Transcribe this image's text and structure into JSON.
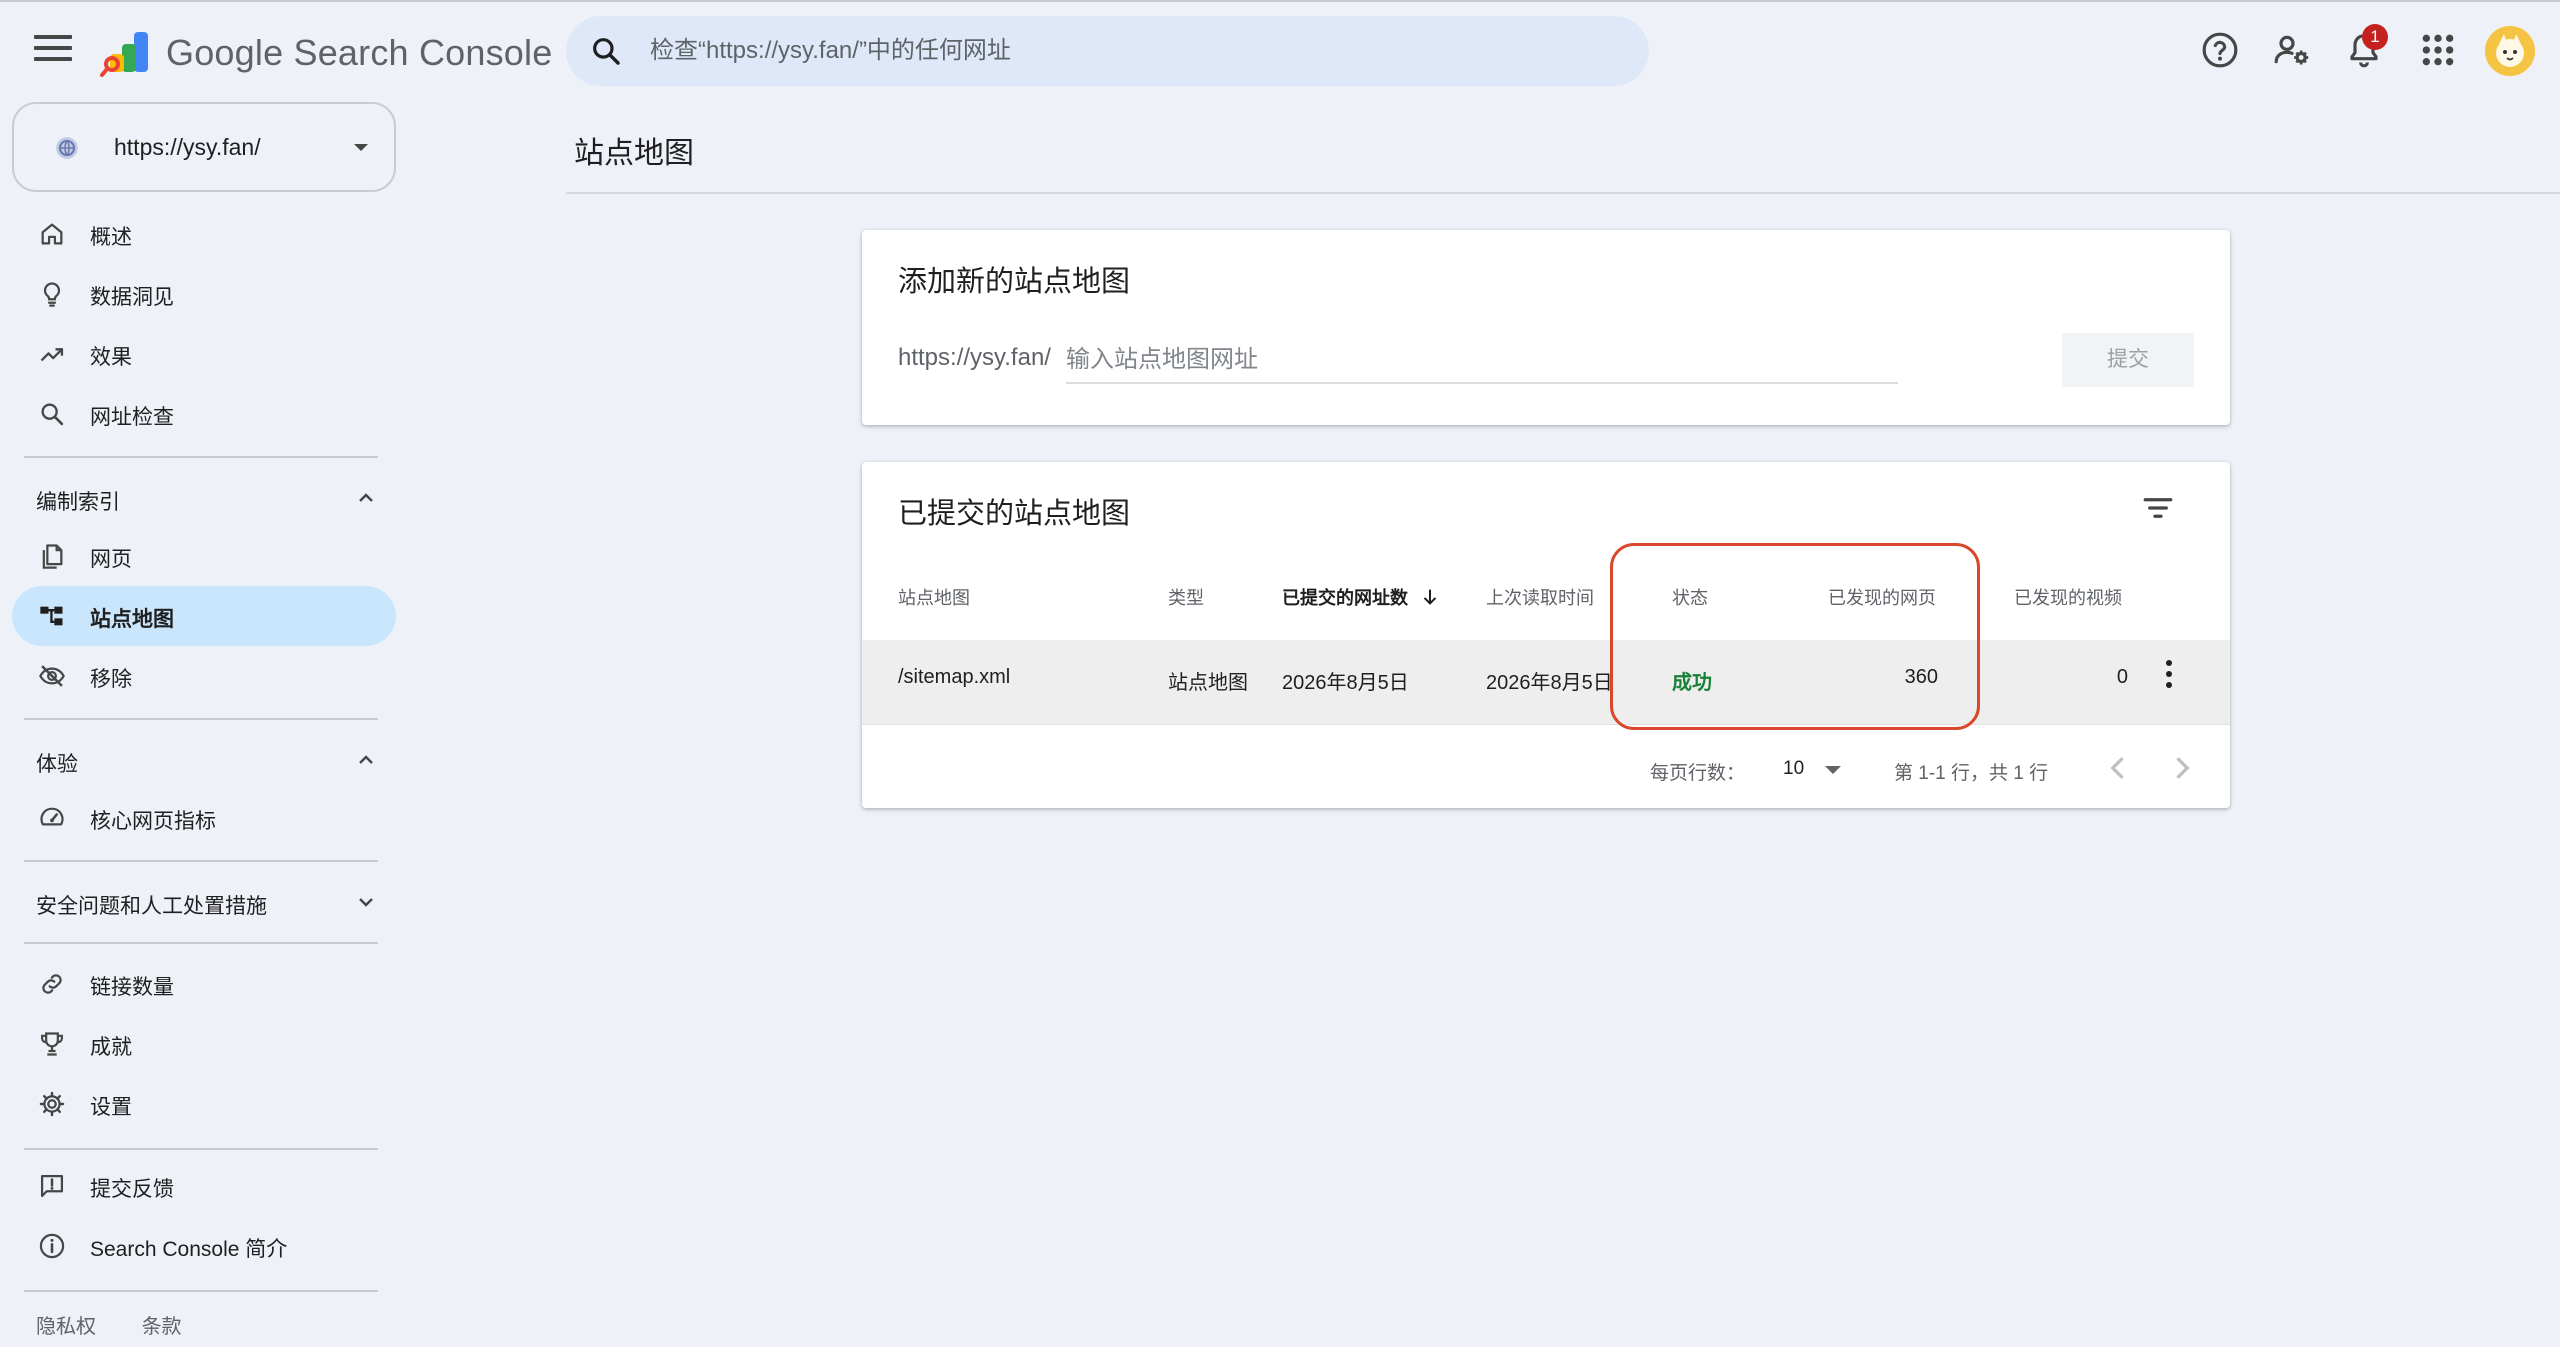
{
  "header": {
    "app_title": "Google Search Console",
    "search_placeholder": "检查“https://ysy.fan/”中的任何网址",
    "notification_count": "1",
    "icons": [
      "menu-icon",
      "search-console-logo",
      "search-icon",
      "help-icon",
      "manage-users-icon",
      "notifications-icon",
      "apps-grid-icon",
      "account-avatar"
    ]
  },
  "property": {
    "url": "https://ysy.fan/"
  },
  "sidebar": {
    "items": [
      {
        "label": "概述",
        "icon": "home-icon"
      },
      {
        "label": "数据洞见",
        "icon": "lightbulb-icon"
      },
      {
        "label": "效果",
        "icon": "trending-up-icon"
      },
      {
        "label": "网址检查",
        "icon": "search-icon"
      }
    ],
    "section_index": {
      "label": "编制索引",
      "items": [
        {
          "label": "网页",
          "icon": "pages-icon"
        },
        {
          "label": "站点地图",
          "icon": "sitemap-icon",
          "active": true
        },
        {
          "label": "移除",
          "icon": "visibility-off-icon"
        }
      ]
    },
    "section_experience": {
      "label": "体验",
      "items": [
        {
          "label": "核心网页指标",
          "icon": "speed-icon"
        }
      ]
    },
    "section_security": {
      "label": "安全问题和人工处置措施"
    },
    "more_items": [
      {
        "label": "链接数量",
        "icon": "link-icon"
      },
      {
        "label": "成就",
        "icon": "trophy-icon"
      },
      {
        "label": "设置",
        "icon": "settings-icon"
      }
    ],
    "bottom_items": [
      {
        "label": "提交反馈",
        "icon": "feedback-icon"
      },
      {
        "label": "Search Console 简介",
        "icon": "info-icon"
      }
    ],
    "footer": {
      "privacy": "隐私权",
      "terms": "条款"
    }
  },
  "main": {
    "page_title": "站点地图",
    "add_card": {
      "title": "添加新的站点地图",
      "prefix": "https://ysy.fan/",
      "input_placeholder": "输入站点地图网址",
      "submit_label": "提交"
    },
    "submitted_card": {
      "title": "已提交的站点地图",
      "columns": {
        "sitemap": "站点地图",
        "type": "类型",
        "submitted": "已提交的网址数",
        "last_read": "上次读取时间",
        "status": "状态",
        "discovered_pages": "已发现的网页",
        "discovered_videos": "已发现的视频"
      },
      "rows": [
        {
          "sitemap": "/sitemap.xml",
          "type": "站点地图",
          "submitted": "2026年8月5日",
          "last_read": "2026年8月5日",
          "status": "成功",
          "discovered_pages": "360",
          "discovered_videos": "0"
        }
      ],
      "pager": {
        "rows_per_page_label": "每页行数：",
        "rows_per_page_value": "10",
        "range_text": "第 1-1 行，共 1 行"
      }
    }
  },
  "colors": {
    "background": "#eef2f8",
    "active_nav": "#c9e6fd",
    "success": "#188038",
    "highlight_border": "#d9482b",
    "badge": "#c5221f"
  }
}
